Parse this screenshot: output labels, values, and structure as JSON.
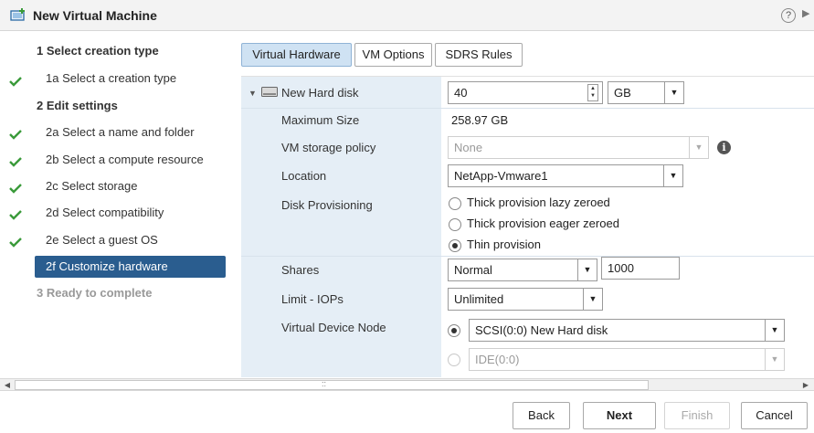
{
  "window": {
    "title": "New Virtual Machine",
    "help_icon": "question-circle-icon",
    "help_glyph": "?",
    "more_glyph": "▶"
  },
  "steps": [
    {
      "label": "1 Select creation type",
      "kind": "head",
      "check": false
    },
    {
      "label": "1a Select a creation type",
      "kind": "sub",
      "check": true
    },
    {
      "label": "2 Edit settings",
      "kind": "head",
      "check": false
    },
    {
      "label": "2a Select a name and folder",
      "kind": "sub",
      "check": true
    },
    {
      "label": "2b Select a compute resource",
      "kind": "sub",
      "check": true
    },
    {
      "label": "2c Select storage",
      "kind": "sub",
      "check": true
    },
    {
      "label": "2d Select compatibility",
      "kind": "sub",
      "check": true
    },
    {
      "label": "2e Select a guest OS",
      "kind": "sub",
      "check": true
    },
    {
      "label": "2f Customize hardware",
      "kind": "active",
      "check": false
    },
    {
      "label": "3 Ready to complete",
      "kind": "disabled",
      "check": false
    }
  ],
  "tabs": [
    {
      "label": "Virtual Hardware",
      "active": true
    },
    {
      "label": "VM Options",
      "active": false
    },
    {
      "label": "SDRS Rules",
      "active": false
    }
  ],
  "hard_disk": {
    "expander": "▼",
    "label": "New Hard disk",
    "size_value": "40",
    "size_unit": "GB",
    "max_size_label": "Maximum Size",
    "max_size_value": "258.97 GB",
    "storage_policy_label": "VM storage policy",
    "storage_policy_value": "None",
    "info_glyph": "i",
    "location_label": "Location",
    "location_value": "NetApp-Vmware1",
    "provisioning_label": "Disk Provisioning",
    "provisioning_options": [
      {
        "label": "Thick provision lazy zeroed",
        "checked": false
      },
      {
        "label": "Thick provision eager zeroed",
        "checked": false
      },
      {
        "label": "Thin provision",
        "checked": true
      }
    ],
    "shares_label": "Shares",
    "shares_value": "Normal",
    "shares_number": "1000",
    "limit_label": "Limit - IOPs",
    "limit_value": "Unlimited",
    "device_node_label": "Virtual Device Node",
    "device_node_options": [
      {
        "label": "SCSI(0:0) New Hard disk",
        "checked": true,
        "disabled": false
      },
      {
        "label": "IDE(0:0)",
        "checked": false,
        "disabled": true
      }
    ]
  },
  "scrollbar": {
    "left_glyph": "◀",
    "right_glyph": "▶",
    "grip_glyph": "::"
  },
  "dropdown_glyph": "▼",
  "spin_up_glyph": "▲",
  "spin_down_glyph": "▼",
  "footer": {
    "back_label": "Back",
    "next_label": "Next",
    "finish_label": "Finish",
    "cancel_label": "Cancel"
  },
  "colors": {
    "accent": "#2a5d8f",
    "check": "#3a9a3a",
    "tab_active": "#cfe2f3",
    "label_column": "#e5eef6"
  }
}
